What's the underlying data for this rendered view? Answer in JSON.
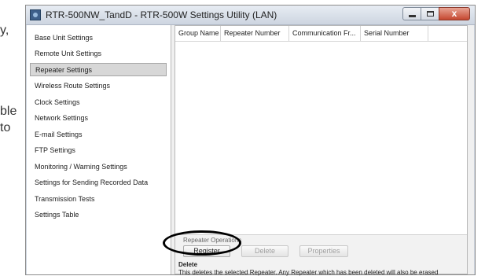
{
  "background": {
    "lines": [
      "y,",
      "ble",
      "to"
    ]
  },
  "window": {
    "title": "RTR-500NW_TandD - RTR-500W Settings Utility (LAN)",
    "controls": {
      "minimize": "minimize",
      "maximize": "maximize",
      "close": "x"
    }
  },
  "sidebar": {
    "items": [
      {
        "label": "Base Unit Settings",
        "selected": false
      },
      {
        "label": "Remote Unit Settings",
        "selected": false
      },
      {
        "label": "Repeater Settings",
        "selected": true
      },
      {
        "label": "Wireless Route Settings",
        "selected": false
      },
      {
        "label": "Clock Settings",
        "selected": false
      },
      {
        "label": "Network Settings",
        "selected": false
      },
      {
        "label": "E-mail Settings",
        "selected": false
      },
      {
        "label": "FTP Settings",
        "selected": false
      },
      {
        "label": "Monitoring / Warning Settings",
        "selected": false
      },
      {
        "label": "Settings for Sending Recorded Data",
        "selected": false
      },
      {
        "label": "Transmission Tests",
        "selected": false
      },
      {
        "label": "Settings Table",
        "selected": false
      }
    ]
  },
  "table": {
    "columns": [
      "Group Name",
      "Repeater Number",
      "Communication Fr...",
      "Serial Number"
    ]
  },
  "operations": {
    "label": "Repeater Operations",
    "register": "Register",
    "delete": "Delete",
    "properties": "Properties",
    "desc_title": "Delete",
    "desc_text": "This deletes the selected Repeater. Any Repeater which has been deleted will also be erased"
  }
}
